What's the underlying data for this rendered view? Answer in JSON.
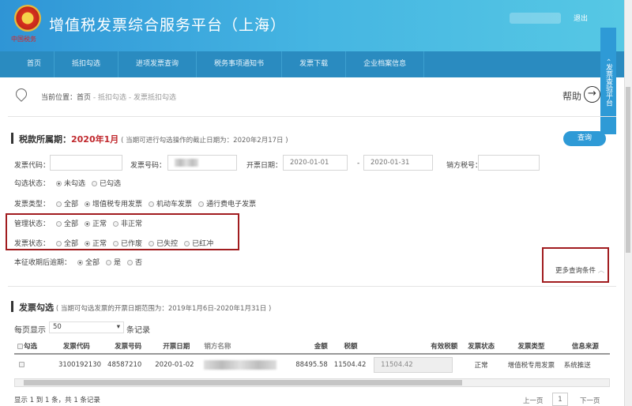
{
  "header": {
    "title": "增值税发票综合服务平台（上海）",
    "logo_text": "中国税务",
    "logout": "退出"
  },
  "nav": [
    "首页",
    "抵扣勾选",
    "进项发票查询",
    "税务事项通知书",
    "发票下载",
    "企业档案信息"
  ],
  "side_tab": "发票查验平台",
  "breadcrumb": {
    "prefix": "当前位置：",
    "home": "首页",
    "sep": " - ",
    "level2": "抵扣勾选",
    "level3": "发票抵扣勾选"
  },
  "help": "帮助",
  "query_section": {
    "title": "税款所属期：",
    "period": "2020年1月",
    "note": "( 当期可进行勾选操作的截止日期为：2020年2月17日 )",
    "query_button": "查询",
    "fields": {
      "code_label": "发票代码：",
      "code_value": "",
      "number_label": "发票号码：",
      "date_label": "开票日期：",
      "date_from": "2020-01-01",
      "date_sep": "-",
      "date_to": "2020-01-31",
      "seller_tax_label": "销方税号：",
      "seller_tax_value": ""
    },
    "radio_groups": [
      {
        "label": "勾选状态：",
        "options": [
          "未勾选",
          "已勾选"
        ],
        "selected": 0
      },
      {
        "label": "发票类型：",
        "options": [
          "全部",
          "增值税专用发票",
          "机动车发票",
          "通行费电子发票"
        ],
        "selected": 1
      },
      {
        "label": "管理状态：",
        "options": [
          "全部",
          "正常",
          "非正常"
        ],
        "selected": 1
      },
      {
        "label": "发票状态：",
        "options": [
          "全部",
          "正常",
          "已作废",
          "已失控",
          "已红冲"
        ],
        "selected": 1
      },
      {
        "label": "本征收期后逾期：",
        "options": [
          "全部",
          "是",
          "否"
        ],
        "selected": 0
      }
    ],
    "more_conditions": "更多查询条件"
  },
  "list_section": {
    "title": "发票勾选",
    "note": "( 当期可勾选发票的开票日期范围为：2019年1月6日-2020年1月31日 )",
    "per_page_label": "每页显示",
    "per_page_value": "50",
    "per_page_suffix": "条记录",
    "columns": [
      "勾选",
      "发票代码",
      "发票号码",
      "开票日期",
      "销方名称",
      "金额",
      "税额",
      "有效税额",
      "发票状态",
      "发票类型",
      "信息来源"
    ],
    "rows": [
      {
        "code": "3100192130",
        "number": "48587210",
        "date": "2020-01-02",
        "amount": "88495.58",
        "tax": "11504.42",
        "valid_tax": "11504.42",
        "status": "正常",
        "type": "增值税专用发票",
        "source": "系统推送"
      }
    ],
    "footer": "显示 1 到 1 条，共 1 条记录",
    "pagination": {
      "prev": "上一页",
      "current": "1",
      "next": "下一页"
    }
  }
}
